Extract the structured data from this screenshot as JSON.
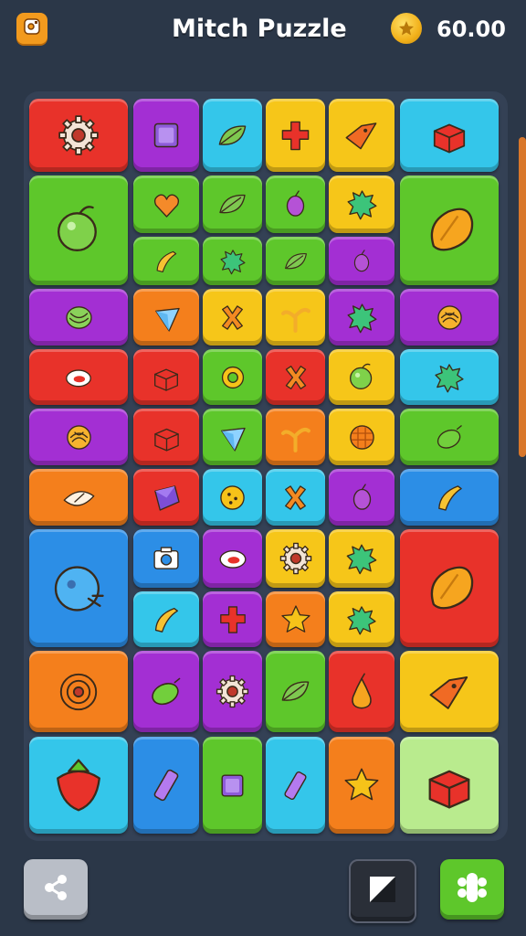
{
  "header": {
    "menu_icon": "menu-icon",
    "title": "Mitch Puzzle",
    "coin_icon": "star-coin-icon",
    "coins": "60.00"
  },
  "colors": {
    "red": "#e8322a",
    "purple": "#a32fd3",
    "cyan": "#34c6ea",
    "yellow": "#f6c619",
    "orange": "#f47f1c",
    "green": "#5ec72b",
    "blue": "#2c8ee6",
    "lime": "#b9eb8e",
    "background": "#2b3748"
  },
  "tiles": [
    {
      "color": "red",
      "icon": "gear-icon"
    },
    {
      "color": "purple",
      "icon": "square-gem-icon"
    },
    {
      "color": "cyan",
      "icon": "leaf-icon"
    },
    {
      "color": "yellow",
      "icon": "cross-icon"
    },
    {
      "color": "yellow",
      "icon": "bird-icon"
    },
    {
      "color": "cyan",
      "icon": "box-icon"
    },
    {
      "color": "green",
      "icon": "apple-icon"
    },
    {
      "color": "green",
      "icon": "heart-icon"
    },
    {
      "color": "green",
      "icon": "leaf-icon"
    },
    {
      "color": "green",
      "icon": "berry-icon"
    },
    {
      "color": "yellow",
      "icon": "splat-icon"
    },
    {
      "color": "green",
      "icon": "mango-icon"
    },
    {
      "color": "green",
      "icon": "banana-icon"
    },
    {
      "color": "green",
      "icon": "splat-icon"
    },
    {
      "color": "green",
      "icon": "leaf-icon"
    },
    {
      "color": "purple",
      "icon": "berry-icon"
    },
    {
      "color": "purple",
      "icon": "melon-icon"
    },
    {
      "color": "orange",
      "icon": "triangle-icon"
    },
    {
      "color": "yellow",
      "icon": "x-icon"
    },
    {
      "color": "yellow",
      "icon": "sprout-icon"
    },
    {
      "color": "purple",
      "icon": "splat-icon"
    },
    {
      "color": "purple",
      "icon": "shell-icon"
    },
    {
      "color": "red",
      "icon": "ring-icon"
    },
    {
      "color": "red",
      "icon": "box-icon"
    },
    {
      "color": "green",
      "icon": "dial-icon"
    },
    {
      "color": "red",
      "icon": "x-icon"
    },
    {
      "color": "yellow",
      "icon": "apple-icon"
    },
    {
      "color": "cyan",
      "icon": "splat-icon"
    },
    {
      "color": "purple",
      "icon": "shell-icon"
    },
    {
      "color": "red",
      "icon": "box-icon"
    },
    {
      "color": "green",
      "icon": "triangle-icon"
    },
    {
      "color": "orange",
      "icon": "sprout-icon"
    },
    {
      "color": "yellow",
      "icon": "ball-icon"
    },
    {
      "color": "green",
      "icon": "lemon-icon"
    },
    {
      "color": "orange",
      "icon": "eye-icon"
    },
    {
      "color": "red",
      "icon": "gem-icon"
    },
    {
      "color": "cyan",
      "icon": "cookie-icon"
    },
    {
      "color": "cyan",
      "icon": "x-icon"
    },
    {
      "color": "purple",
      "icon": "berry-icon"
    },
    {
      "color": "blue",
      "icon": "banana-icon"
    },
    {
      "color": "blue",
      "icon": "skull-icon"
    },
    {
      "color": "blue",
      "icon": "camera-icon"
    },
    {
      "color": "purple",
      "icon": "ring-icon"
    },
    {
      "color": "yellow",
      "icon": "gear-icon"
    },
    {
      "color": "yellow",
      "icon": "splat-icon"
    },
    {
      "color": "red",
      "icon": "mango-icon"
    },
    {
      "color": "cyan",
      "icon": "banana-icon"
    },
    {
      "color": "purple",
      "icon": "cross-icon"
    },
    {
      "color": "orange",
      "icon": "star-icon"
    },
    {
      "color": "yellow",
      "icon": "splat-icon"
    },
    {
      "color": "orange",
      "icon": "target-icon"
    },
    {
      "color": "purple",
      "icon": "lemon-icon"
    },
    {
      "color": "purple",
      "icon": "gear-icon"
    },
    {
      "color": "green",
      "icon": "leaf-icon"
    },
    {
      "color": "red",
      "icon": "pear-icon"
    },
    {
      "color": "yellow",
      "icon": "bird-icon"
    },
    {
      "color": "cyan",
      "icon": "strawberry-icon"
    },
    {
      "color": "blue",
      "icon": "bar-icon"
    },
    {
      "color": "green",
      "icon": "square-gem-icon"
    },
    {
      "color": "cyan",
      "icon": "bar-icon"
    },
    {
      "color": "orange",
      "icon": "star-icon"
    },
    {
      "color": "lime",
      "icon": "box-icon"
    }
  ],
  "footer": {
    "share_icon": "share-icon",
    "edit_icon": "edit-icon",
    "grid_icon": "grid-icon"
  }
}
